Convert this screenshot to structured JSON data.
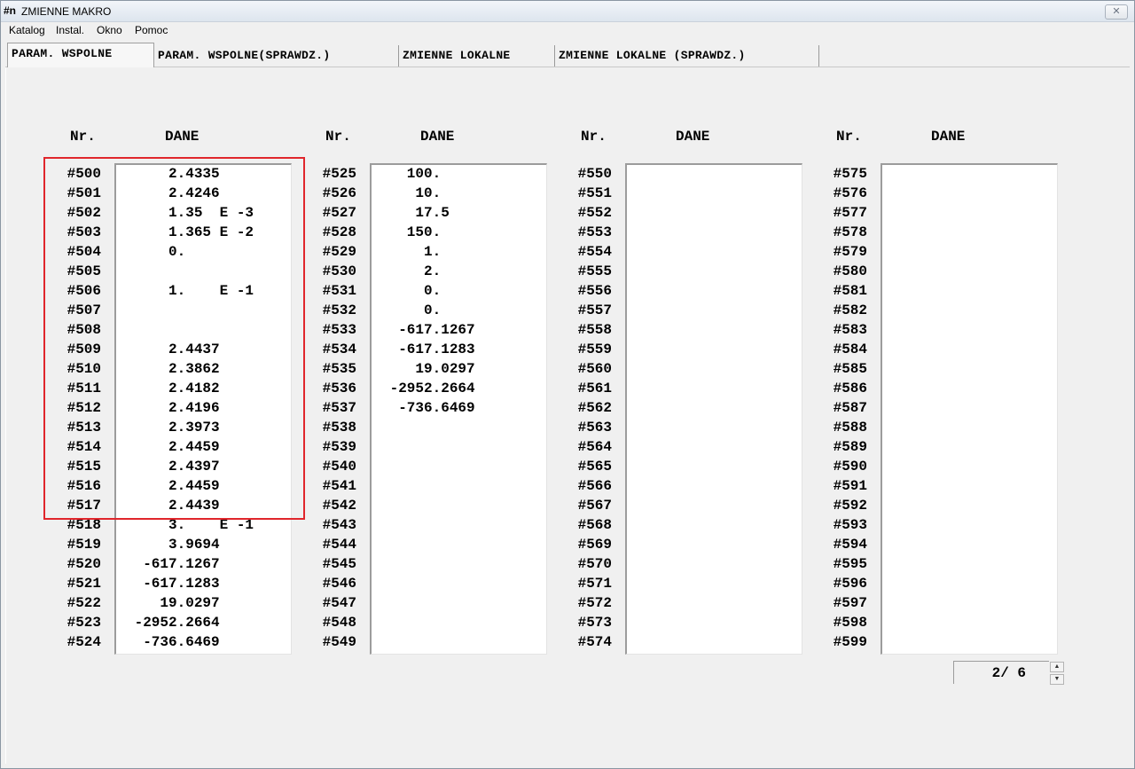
{
  "window": {
    "icon": "#n",
    "title": "ZMIENNE MAKRO",
    "close": "✕"
  },
  "menu": [
    "Katalog",
    "Instal.",
    "Okno",
    "Pomoc"
  ],
  "tabs": [
    "PARAM. WSPOLNE",
    "PARAM. WSPOLNE(SPRAWDZ.)",
    "ZMIENNE LOKALNE",
    "ZMIENNE LOKALNE (SPRAWDZ.)"
  ],
  "headers": {
    "nr": "Nr.",
    "data": "DANE"
  },
  "columns": [
    {
      "labels": [
        "#500",
        "#501",
        "#502",
        "#503",
        "#504",
        "#505",
        "#506",
        "#507",
        "#508",
        "#509",
        "#510",
        "#511",
        "#512",
        "#513",
        "#514",
        "#515",
        "#516",
        "#517",
        "#518",
        "#519",
        "#520",
        "#521",
        "#522",
        "#523",
        "#524"
      ],
      "values": [
        "     2.4335",
        "     2.4246",
        "     1.35  E -3",
        "     1.365 E -2",
        "     0.",
        "",
        "     1.    E -1",
        "",
        "",
        "     2.4437",
        "     2.3862",
        "     2.4182",
        "     2.4196",
        "     2.3973",
        "     2.4459",
        "     2.4397",
        "     2.4459",
        "     2.4439",
        "     3.    E -1",
        "     3.9694",
        "  -617.1267",
        "  -617.1283",
        "    19.0297",
        " -2952.2664",
        "  -736.6469"
      ]
    },
    {
      "labels": [
        "#525",
        "#526",
        "#527",
        "#528",
        "#529",
        "#530",
        "#531",
        "#532",
        "#533",
        "#534",
        "#535",
        "#536",
        "#537",
        "#538",
        "#539",
        "#540",
        "#541",
        "#542",
        "#543",
        "#544",
        "#545",
        "#546",
        "#547",
        "#548",
        "#549"
      ],
      "values": [
        "   100.",
        "    10.",
        "    17.5",
        "   150.",
        "     1.",
        "     2.",
        "     0.",
        "     0.",
        "  -617.1267",
        "  -617.1283",
        "    19.0297",
        " -2952.2664",
        "  -736.6469",
        "",
        "",
        "",
        "",
        "",
        "",
        "",
        "",
        "",
        "",
        "",
        ""
      ]
    },
    {
      "labels": [
        "#550",
        "#551",
        "#552",
        "#553",
        "#554",
        "#555",
        "#556",
        "#557",
        "#558",
        "#559",
        "#560",
        "#561",
        "#562",
        "#563",
        "#564",
        "#565",
        "#566",
        "#567",
        "#568",
        "#569",
        "#570",
        "#571",
        "#572",
        "#573",
        "#574"
      ],
      "values": []
    },
    {
      "labels": [
        "#575",
        "#576",
        "#577",
        "#578",
        "#579",
        "#580",
        "#581",
        "#582",
        "#583",
        "#584",
        "#585",
        "#586",
        "#587",
        "#588",
        "#589",
        "#590",
        "#591",
        "#592",
        "#593",
        "#594",
        "#595",
        "#596",
        "#597",
        "#598",
        "#599"
      ],
      "values": []
    }
  ],
  "pager": {
    "text": "2/  6"
  },
  "colors": {
    "highlight": "#e0262c"
  }
}
